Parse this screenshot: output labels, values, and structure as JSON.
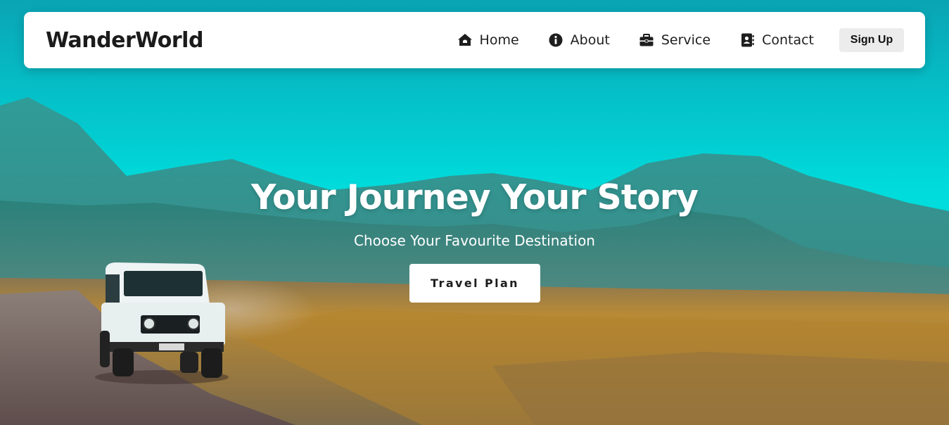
{
  "brand": {
    "name": "WanderWorld"
  },
  "nav": {
    "items": [
      {
        "label": "Home",
        "icon": "home-icon"
      },
      {
        "label": "About",
        "icon": "info-circle-icon"
      },
      {
        "label": "Service",
        "icon": "briefcase-icon"
      },
      {
        "label": "Contact",
        "icon": "contact-book-icon"
      }
    ],
    "signup_label": "Sign Up"
  },
  "hero": {
    "headline": "Your Journey Your Story",
    "subheadline": "Choose Your Favourite Destination",
    "cta_label": "Travel Plan",
    "background": "jeep-on-dirt-road-with-mountains-and-grassland"
  },
  "colors": {
    "sky": "#00e1e0",
    "mountain": "#2e8d88",
    "grass": "#c28a2a",
    "nav_bg": "#ffffff",
    "text_dark": "#1b1b1b",
    "signup_bg": "#ececec"
  }
}
